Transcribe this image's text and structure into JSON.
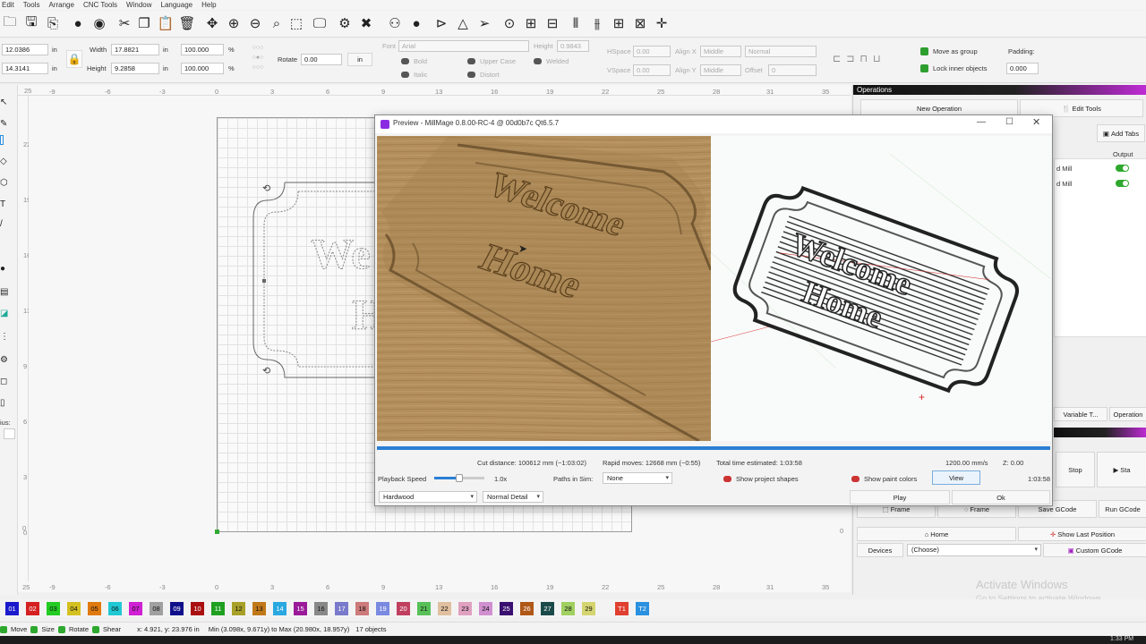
{
  "menubar": {
    "items": [
      "Edit",
      "Tools",
      "Arrange",
      "CNC Tools",
      "Window",
      "Language",
      "Help"
    ]
  },
  "props": {
    "x_value": "12.0386",
    "y_value": "14.3141",
    "x_unit": "in",
    "y_unit": "in",
    "width_label": "Width",
    "width_value": "17.8821",
    "width_unit": "in",
    "height_label": "Height",
    "height_value": "9.2858",
    "height_unit": "in",
    "wpct": "100.000",
    "hpct": "100.000",
    "pct_unit": "%",
    "rotate_label": "Rotate",
    "rotate_value": "0.00",
    "in_button": "in",
    "font_label": "Font",
    "font_value": "Arial",
    "fheight_label": "Height",
    "fheight_value": "0.9843",
    "bold": "Bold",
    "italic": "Italic",
    "upper": "Upper Case",
    "distort": "Distort",
    "welded": "Welded",
    "hspace_label": "HSpace",
    "hspace_value": "0.00",
    "vspace_label": "VSpace",
    "vspace_value": "0.00",
    "alignx_label": "Align X",
    "alignx_value": "Middle",
    "aligny_label": "Align Y",
    "aligny_value": "Middle",
    "normal_value": "Normal",
    "offset_label": "Offset",
    "offset_value": "0",
    "move_group": "Move as group",
    "lock_inner": "Lock inner objects",
    "padding_label": "Padding:",
    "padding_value": "0.000"
  },
  "ruler": {
    "top": [
      "-9",
      "-6",
      "-3",
      "0",
      "3",
      "6",
      "9",
      "13",
      "16",
      "19",
      "22",
      "25",
      "28",
      "31",
      "35"
    ],
    "left": [
      "22",
      "19",
      "16",
      "13",
      "9",
      "6",
      "3",
      "0"
    ],
    "corner_top": "25",
    "corner_right": "25",
    "right_zero": "0"
  },
  "canvas_text": {
    "left_frag": "We",
    "left_frag2": "H"
  },
  "operations": {
    "title": "Operations",
    "new_op": "New Operation",
    "edit_tools": "Edit Tools",
    "add_tabs": "Add Tabs",
    "output_col": "Output",
    "row1": "d Mill",
    "row2": "d Mill",
    "tab_var": "Variable T...",
    "tab_ops": "Operation",
    "stop": "Stop",
    "start": "Sta",
    "frame1": "Frame",
    "frame2": "Frame",
    "save_gcode": "Save GCode",
    "run_gcode": "Run GCode",
    "home": "Home",
    "show_last": "Show Last Position",
    "devices": "Devices",
    "choose": "(Choose)",
    "custom_gcode": "Custom GCode"
  },
  "dialog": {
    "title": "Preview - MillMage 0.8.00-RC-4 @ 00d0b7c Qt6.5.7",
    "stats_cut": "Cut distance: 100612 mm (~1:03:02)",
    "stats_rapid": "Rapid moves: 12668 mm (~0:55)",
    "stats_total": "Total time estimated: 1:03:58",
    "feed": "1200.00 mm/s",
    "z_readout": "Z: 0.00",
    "playback_label": "Playback Speed",
    "playback_value": "1.0x",
    "playback_fraction": 0.5,
    "progress_fraction": 1.0,
    "paths_label": "Paths in Sim:",
    "paths_value": "None",
    "show_project_shapes": "Show project shapes",
    "show_paint_colors": "Show paint colors",
    "view_button": "View",
    "time_value": "1:03:58",
    "material": "Hardwood",
    "detail": "Normal Detail",
    "play_button": "Play",
    "ok_button": "Ok",
    "wood_line1": "Welcome",
    "wood_line2": "Home",
    "sim_line1": "Welcome",
    "sim_line2": "Home"
  },
  "palette": [
    "01",
    "02",
    "03",
    "04",
    "05",
    "06",
    "07",
    "08",
    "09",
    "10",
    "11",
    "12",
    "13",
    "14",
    "15",
    "16",
    "17",
    "18",
    "19",
    "20",
    "21",
    "22",
    "23",
    "24",
    "25",
    "26",
    "27",
    "28",
    "29",
    "T1",
    "T2"
  ],
  "palette_colors": [
    "#1a1acc",
    "#d42020",
    "#22cc22",
    "#d4c020",
    "#e07a10",
    "#20c8d4",
    "#d020d4",
    "#a0a0a0",
    "#10108a",
    "#aa1010",
    "#20a020",
    "#a8a028",
    "#c07818",
    "#2aa8e0",
    "#9a1a9a",
    "#888888",
    "#7a7acc",
    "#cc7a7a",
    "#7a8ae0",
    "#c04060",
    "#58c058",
    "#e0c0a0",
    "#e0a0c0",
    "#d090d0",
    "#3a1070",
    "#b05818",
    "#1a4a4a",
    "#a0d060",
    "#d4d470",
    "#e04030",
    "#2a90e0"
  ],
  "status": {
    "move": "Move",
    "size": "Size",
    "rotate": "Rotate",
    "shear": "Shear",
    "coords": "x: 4.921, y: 23.976 in",
    "bounds": "Min (3.098x, 9.671y) to Max (20.980x, 18.957y)",
    "objects": "17 objects"
  },
  "watermark": {
    "line1": "Activate Windows",
    "line2": "Go to Settings to activate Windows."
  },
  "taskbar": {
    "time": "1:33 PM"
  },
  "left_labels": {
    "ius": "ius:"
  }
}
